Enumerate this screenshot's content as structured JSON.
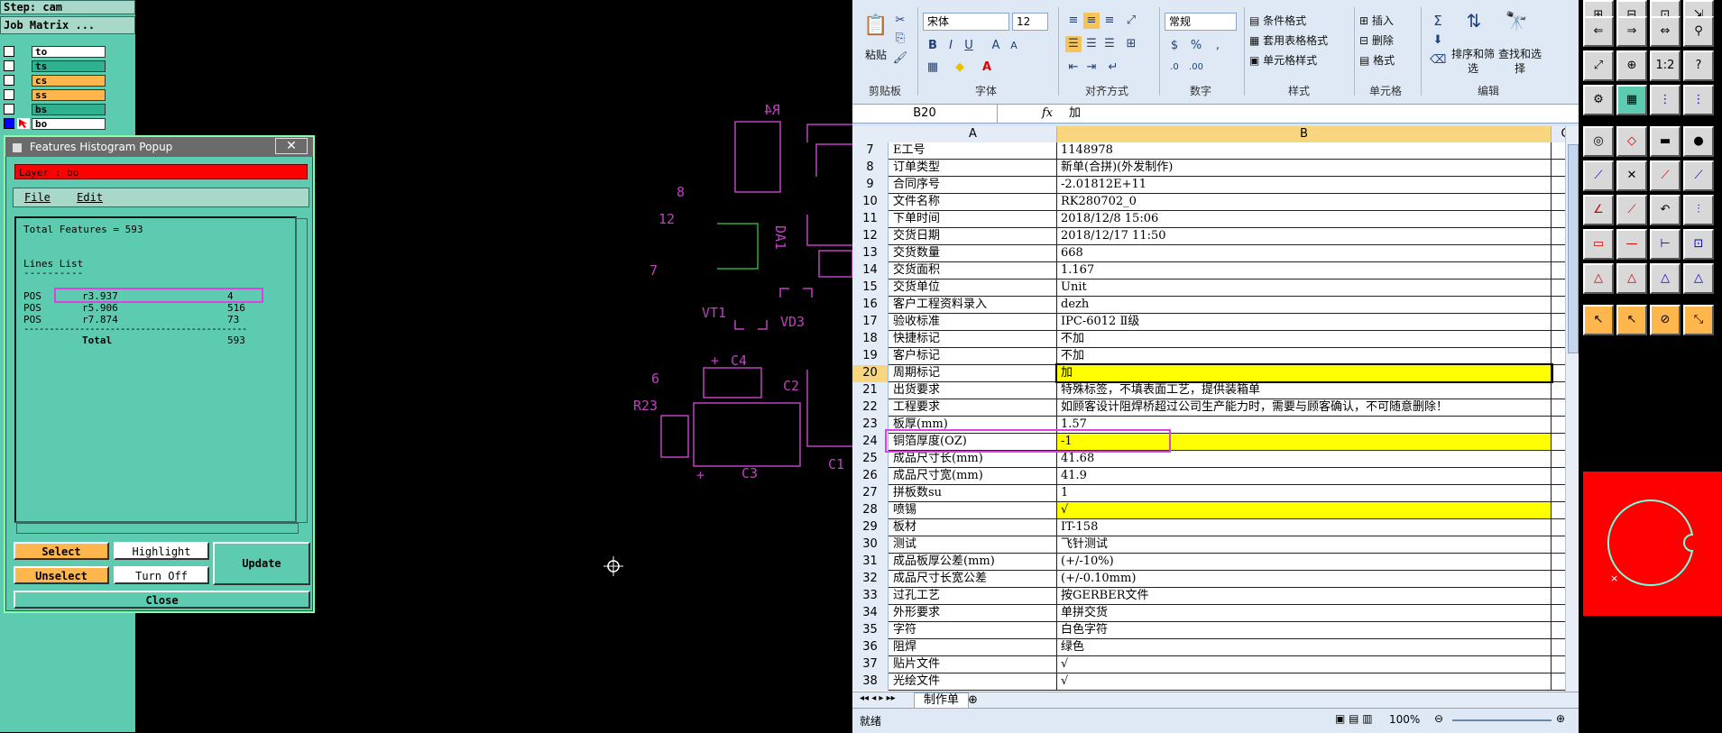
{
  "cam": {
    "step_label": "Step: cam",
    "job_matrix_label": "Job Matrix ...",
    "layers": [
      {
        "name": "to",
        "color": "#ffffff"
      },
      {
        "name": "ts",
        "color": "#2fb08f"
      },
      {
        "name": "cs",
        "color": "#ffb64d"
      },
      {
        "name": "ss",
        "color": "#ffb64d"
      },
      {
        "name": "bs",
        "color": "#2fb08f"
      },
      {
        "name": "bo",
        "color": "#ffffff"
      }
    ]
  },
  "popup": {
    "title": "Features Histogram Popup",
    "close_glyph": "✕",
    "layer_label": "Layer :  bo",
    "menu": [
      "File",
      "Edit"
    ],
    "total_features": "Total Features = 593",
    "lines_list_label": "Lines List",
    "underline": "----------",
    "rows": [
      {
        "type": "POS",
        "symbol": "r3.937",
        "count": "4"
      },
      {
        "type": "POS",
        "symbol": "r5.906",
        "count": "516"
      },
      {
        "type": "POS",
        "symbol": "r7.874",
        "count": "73"
      }
    ],
    "divider": "--------------------------------------------",
    "total_label": "Total",
    "total_value": "593",
    "buttons": {
      "select": "Select",
      "highlight": "Highlight",
      "update": "Update",
      "unselect": "Unselect",
      "turn_off": "Turn Off",
      "close": "Close"
    }
  },
  "pcb": {
    "labels": [
      "R4",
      "8",
      "12",
      "DA1",
      "7",
      "VT1",
      "VD3",
      "C4",
      "6",
      "C2",
      "R23",
      "C3",
      "C1",
      "+",
      "+"
    ]
  },
  "excel": {
    "clipboard": {
      "paste": "粘贴",
      "label": "剪贴板"
    },
    "font": {
      "name": "宋体",
      "size": "12",
      "label": "字体"
    },
    "alignment": {
      "label": "对齐方式"
    },
    "number": {
      "format": "常规",
      "label": "数字"
    },
    "styles": {
      "cond": "条件格式",
      "table": "套用表格格式",
      "cell": "单元格样式",
      "label": "样式"
    },
    "cells": {
      "insert": "插入",
      "delete": "删除",
      "format": "格式",
      "label": "单元格"
    },
    "editing": {
      "sort": "排序和筛选",
      "find": "查找和选择",
      "label": "编辑"
    },
    "name_box": "B20",
    "fx": "fx",
    "formula": "加",
    "columns": [
      "A",
      "B",
      "C"
    ],
    "rows": [
      {
        "n": "7",
        "a": "E工号",
        "b": "1148978"
      },
      {
        "n": "8",
        "a": "订单类型",
        "b": "新单(合拼)(外发制作)"
      },
      {
        "n": "9",
        "a": "合同序号",
        "b": "-2.01812E+11"
      },
      {
        "n": "10",
        "a": "文件名称",
        "b": "RK280702_0"
      },
      {
        "n": "11",
        "a": "下单时间",
        "b": "2018/12/8 15:06"
      },
      {
        "n": "12",
        "a": "交货日期",
        "b": "2018/12/17 11:50"
      },
      {
        "n": "13",
        "a": "交货数量",
        "b": "668"
      },
      {
        "n": "14",
        "a": "交货面积",
        "b": "1.167"
      },
      {
        "n": "15",
        "a": "交货单位",
        "b": "Unit"
      },
      {
        "n": "16",
        "a": "客户工程资料录入",
        "b": "dezh"
      },
      {
        "n": "17",
        "a": "验收标准",
        "b": "IPC-6012 Ⅱ级"
      },
      {
        "n": "18",
        "a": "快捷标记",
        "b": "不加"
      },
      {
        "n": "19",
        "a": "客户标记",
        "b": "不加"
      },
      {
        "n": "20",
        "a": "周期标记",
        "b": "加",
        "highlight": true,
        "active": true
      },
      {
        "n": "21",
        "a": "出货要求",
        "b": "特殊标签，不填表面工艺，提供装箱单"
      },
      {
        "n": "22",
        "a": "工程要求",
        "b": "如顾客设计阻焊桥超过公司生产能力时，需要与顾客确认，不可随意删除！"
      },
      {
        "n": "23",
        "a": "板厚(mm)",
        "b": "1.57"
      },
      {
        "n": "24",
        "a": "铜箔厚度(OZ)",
        "b": "-1",
        "highlight": true
      },
      {
        "n": "25",
        "a": "成品尺寸长(mm)",
        "b": "41.68"
      },
      {
        "n": "26",
        "a": "成品尺寸宽(mm)",
        "b": "41.9"
      },
      {
        "n": "27",
        "a": "拼板数su",
        "b": "1"
      },
      {
        "n": "28",
        "a": "喷锡",
        "b": "√",
        "highlight": true
      },
      {
        "n": "29",
        "a": "板材",
        "b": "IT-158"
      },
      {
        "n": "30",
        "a": "测试",
        "b": "飞针测试"
      },
      {
        "n": "31",
        "a": "成品板厚公差(mm)",
        "b": "(+/-10%)"
      },
      {
        "n": "32",
        "a": "成品尺寸长宽公差",
        "b": "(+/-0.10mm)"
      },
      {
        "n": "33",
        "a": "过孔工艺",
        "b": "按GERBER文件"
      },
      {
        "n": "34",
        "a": "外形要求",
        "b": "单拼交货"
      },
      {
        "n": "35",
        "a": "字符",
        "b": "白色字符"
      },
      {
        "n": "36",
        "a": "阻焊",
        "b": "绿色"
      },
      {
        "n": "37",
        "a": "贴片文件",
        "b": "√"
      },
      {
        "n": "38",
        "a": "光绘文件",
        "b": "√"
      }
    ],
    "sheet_tab": "制作单",
    "status": "就绪",
    "zoom": "100%"
  },
  "colors": {
    "cam_teal": "#5dcbb0",
    "highlight_magenta": "#e040e0",
    "cell_yellow": "#ffff00",
    "pcb_magenta": "#c040c0"
  }
}
